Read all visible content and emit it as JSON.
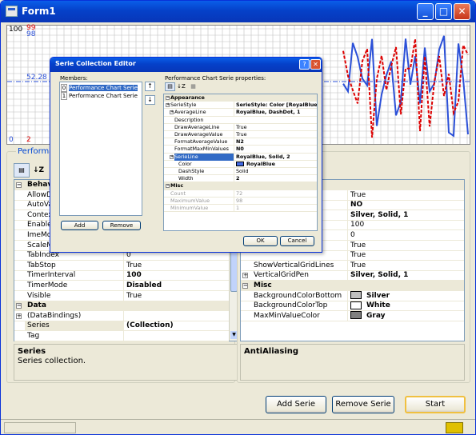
{
  "window": {
    "title": "Form1"
  },
  "chart": {
    "y_top": "100",
    "y_top_red": "99",
    "y_top_blue": "98",
    "y_mid": "52.28",
    "y_bottom_blue": "0",
    "y_bottom_red": "2"
  },
  "main_props": {
    "group_label": "Performanc",
    "rows": [
      {
        "name": "Behavio",
        "value": "",
        "cat": true
      },
      {
        "name": "AllowDro",
        "value": ""
      },
      {
        "name": "AutoValid",
        "value": ""
      },
      {
        "name": "ContextM",
        "value": ""
      },
      {
        "name": "Enabled",
        "value": ""
      },
      {
        "name": "ImeMode",
        "value": ""
      },
      {
        "name": "ScaleMo",
        "value": ""
      },
      {
        "name": "TabIndex",
        "value": "0"
      },
      {
        "name": "TabStop",
        "value": "True"
      },
      {
        "name": "TimerInterval",
        "value": "100",
        "bold": true
      },
      {
        "name": "TimerMode",
        "value": "Disabled",
        "bold": true
      },
      {
        "name": "Visible",
        "value": "True"
      },
      {
        "name": "Data",
        "value": "",
        "cat": true
      },
      {
        "name": "(DataBindings)",
        "value": "",
        "expand": true
      },
      {
        "name": "Series",
        "value": "(Collection)",
        "bold": true,
        "sel": true
      },
      {
        "name": "Tag",
        "value": ""
      }
    ],
    "desc_title": "Series",
    "desc_text": "Series collection."
  },
  "right_props": {
    "rows": [
      {
        "name": "",
        "value": "",
        "cat": true
      },
      {
        "name": "",
        "value": "True"
      },
      {
        "name": "",
        "value": "NO",
        "bold": true
      },
      {
        "name": "",
        "value": "Silver, Solid, 1",
        "bold": true
      },
      {
        "name": "",
        "value": "100"
      },
      {
        "name": "",
        "value": "0"
      },
      {
        "name": "",
        "value": "True"
      },
      {
        "name": "",
        "value": "True"
      },
      {
        "name": "ShowVerticalGridLines",
        "value": "True"
      },
      {
        "name": "VerticalGridPen",
        "value": "Silver, Solid, 1",
        "bold": true,
        "expand": true
      },
      {
        "name": "Misc",
        "value": "",
        "cat": true
      },
      {
        "name": "BackgroundColorBottom",
        "value": "Silver",
        "bold": true,
        "swatch": "#c0c0c0"
      },
      {
        "name": "BackgroundColorTop",
        "value": "White",
        "bold": true,
        "swatch": "#ffffff"
      },
      {
        "name": "MaxMinValueColor",
        "value": "Gray",
        "bold": true,
        "swatch": "#808080"
      }
    ],
    "desc_title": "AntiAliasing"
  },
  "buttons": {
    "add": "Add Serie",
    "remove": "Remove Serie",
    "start": "Start"
  },
  "dialog": {
    "title": "Serie Collection Editor",
    "help": "?",
    "members_label": "Members:",
    "members": [
      {
        "index": "0",
        "label": "Performance Chart Serie"
      },
      {
        "index": "1",
        "label": "Performance Chart Serie"
      }
    ],
    "add": "Add",
    "remove": "Remove",
    "props_label": "Performance Chart Serie properties:",
    "props": [
      {
        "name": "Appearance",
        "value": "",
        "cat": true
      },
      {
        "name": "SerieStyle",
        "value": "SerieStyle: Color [RoyalBlue] Sc",
        "bold": true,
        "ind": 0,
        "expand": true
      },
      {
        "name": "AverageLine",
        "value": "RoyalBlue, DashDot, 1",
        "bold": true,
        "ind": 1,
        "expand": true
      },
      {
        "name": "Description",
        "value": "",
        "ind": 1
      },
      {
        "name": "DrawAverageLine",
        "value": "True",
        "ind": 1
      },
      {
        "name": "DrawAverageValue",
        "value": "True",
        "ind": 1
      },
      {
        "name": "FormatAverageValue",
        "value": "N2",
        "bold": true,
        "ind": 1
      },
      {
        "name": "FormatMaxMinValues",
        "value": "N0",
        "bold": true,
        "ind": 1
      },
      {
        "name": "SerieLine",
        "value": "RoyalBlue, Solid, 2",
        "bold": true,
        "ind": 1,
        "expand": true,
        "sel": true
      },
      {
        "name": "Color",
        "value": "RoyalBlue",
        "bold": true,
        "ind": 2,
        "swatch": "#4169e1"
      },
      {
        "name": "DashStyle",
        "value": "Solid",
        "ind": 2
      },
      {
        "name": "Width",
        "value": "2",
        "bold": true,
        "ind": 2
      },
      {
        "name": "Misc",
        "value": "",
        "cat": true
      },
      {
        "name": "Count",
        "value": "72",
        "ind": 0,
        "dim": true
      },
      {
        "name": "MaximumValue",
        "value": "98",
        "ind": 0,
        "dim": true
      },
      {
        "name": "MinimumValue",
        "value": "1",
        "ind": 0,
        "dim": true
      }
    ],
    "ok": "OK",
    "cancel": "Cancel"
  },
  "colors": {
    "title_blue": "#0541c9",
    "series_red": "#dd0000",
    "series_blue": "#2b50d8",
    "grid": "#c0c0c0",
    "selection": "#316ac5"
  }
}
